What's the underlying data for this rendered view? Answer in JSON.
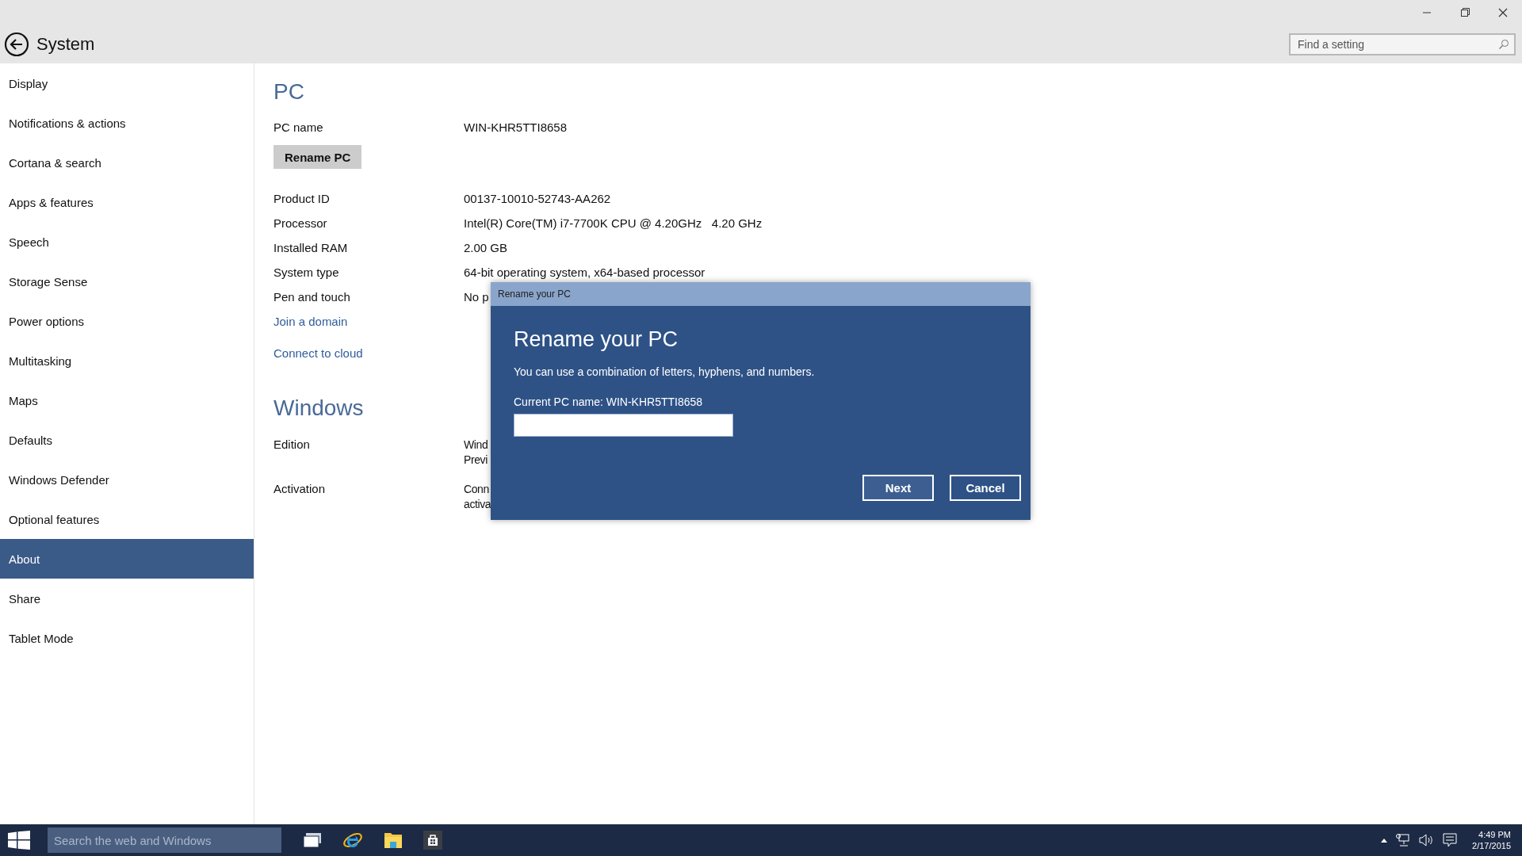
{
  "window": {
    "title": "System"
  },
  "search": {
    "placeholder": "Find a setting"
  },
  "sidebar": {
    "items": [
      {
        "label": "Display",
        "selected": false
      },
      {
        "label": "Notifications & actions",
        "selected": false
      },
      {
        "label": "Cortana & search",
        "selected": false
      },
      {
        "label": "Apps & features",
        "selected": false
      },
      {
        "label": "Speech",
        "selected": false
      },
      {
        "label": "Storage Sense",
        "selected": false
      },
      {
        "label": "Power options",
        "selected": false
      },
      {
        "label": "Multitasking",
        "selected": false
      },
      {
        "label": "Maps",
        "selected": false
      },
      {
        "label": "Defaults",
        "selected": false
      },
      {
        "label": "Windows Defender",
        "selected": false
      },
      {
        "label": "Optional features",
        "selected": false
      },
      {
        "label": "About",
        "selected": true
      },
      {
        "label": "Share",
        "selected": false
      },
      {
        "label": "Tablet Mode",
        "selected": false
      }
    ]
  },
  "pc": {
    "heading": "PC",
    "name_label": "PC name",
    "name_value": "WIN-KHR5TTI8658",
    "rename_button": "Rename PC",
    "properties": [
      {
        "label": "Product ID",
        "value": "00137-10010-52743-AA262"
      },
      {
        "label": "Processor",
        "value": "Intel(R) Core(TM) i7-7700K CPU @ 4.20GHz   4.20 GHz"
      },
      {
        "label": "Installed RAM",
        "value": "2.00 GB"
      },
      {
        "label": "System type",
        "value": "64-bit operating system, x64-based processor"
      },
      {
        "label": "Pen and touch",
        "value": "No p"
      }
    ],
    "links": [
      "Join a domain",
      "Connect to cloud"
    ]
  },
  "windows": {
    "heading": "Windows",
    "properties": [
      {
        "label": "Edition",
        "value_lines": [
          "Wind",
          "Previ"
        ]
      },
      {
        "label": "Activation",
        "value_lines": [
          "Conn",
          "activa"
        ]
      }
    ]
  },
  "dialog": {
    "title": "Rename your PC",
    "heading": "Rename your PC",
    "description": "You can use a combination of letters, hyphens, and numbers.",
    "current_name": "Current PC name: WIN-KHR5TTI8658",
    "buttons": [
      "Next",
      "Cancel"
    ]
  },
  "taskbar": {
    "search_placeholder": "Search the web and Windows",
    "time": "4:49 PM",
    "date": "2/17/2015"
  }
}
